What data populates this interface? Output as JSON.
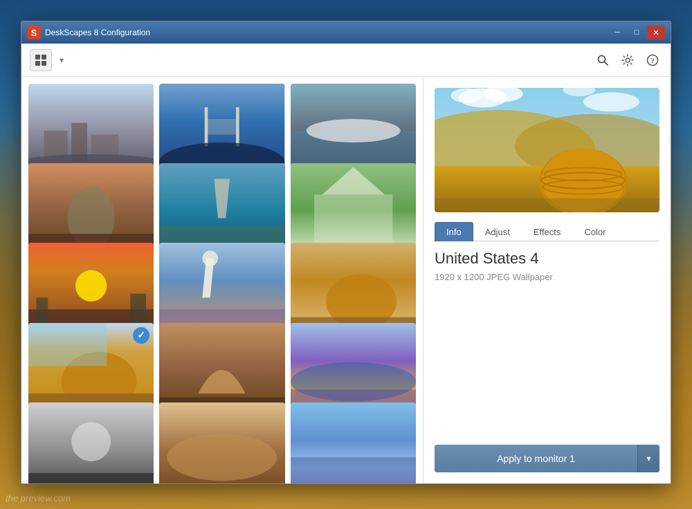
{
  "window": {
    "title": "DeskScapes 8 Configuration",
    "icon_label": "S",
    "min_label": "─",
    "max_label": "□",
    "close_label": "✕"
  },
  "toolbar": {
    "view_icon": "⊞",
    "dropdown_arrow": "▾",
    "search_icon": "🔍",
    "settings_icon": "⚙",
    "help_icon": "?"
  },
  "tabs": [
    {
      "id": "info",
      "label": "Info",
      "active": true
    },
    {
      "id": "adjust",
      "label": "Adjust",
      "active": false
    },
    {
      "id": "effects",
      "label": "Effects",
      "active": false
    },
    {
      "id": "color",
      "label": "Color",
      "active": false
    }
  ],
  "selected_wallpaper": {
    "name": "United States 4",
    "meta": "1920 x 1200 JPEG Wallpaper"
  },
  "apply_button": {
    "label": "Apply to monitor 1",
    "dropdown_arrow": "▾"
  },
  "thumbnails": [
    {
      "id": 1,
      "class": "thumb-1",
      "selected": false
    },
    {
      "id": 2,
      "class": "thumb-2",
      "selected": false
    },
    {
      "id": 3,
      "class": "thumb-3",
      "selected": false
    },
    {
      "id": 4,
      "class": "thumb-4",
      "selected": false
    },
    {
      "id": 5,
      "class": "thumb-5",
      "selected": false
    },
    {
      "id": 6,
      "class": "thumb-6",
      "selected": false
    },
    {
      "id": 7,
      "class": "thumb-7",
      "selected": false
    },
    {
      "id": 8,
      "class": "thumb-8",
      "selected": false
    },
    {
      "id": 9,
      "class": "thumb-9",
      "selected": false
    },
    {
      "id": 10,
      "class": "thumb-10",
      "selected": true
    },
    {
      "id": 11,
      "class": "thumb-11",
      "selected": false
    },
    {
      "id": 12,
      "class": "thumb-12",
      "selected": false
    },
    {
      "id": 13,
      "class": "thumb-13",
      "selected": false
    },
    {
      "id": 14,
      "class": "thumb-14",
      "selected": false
    },
    {
      "id": 15,
      "class": "thumb-15",
      "selected": false
    }
  ],
  "watermark": "the preview.com"
}
